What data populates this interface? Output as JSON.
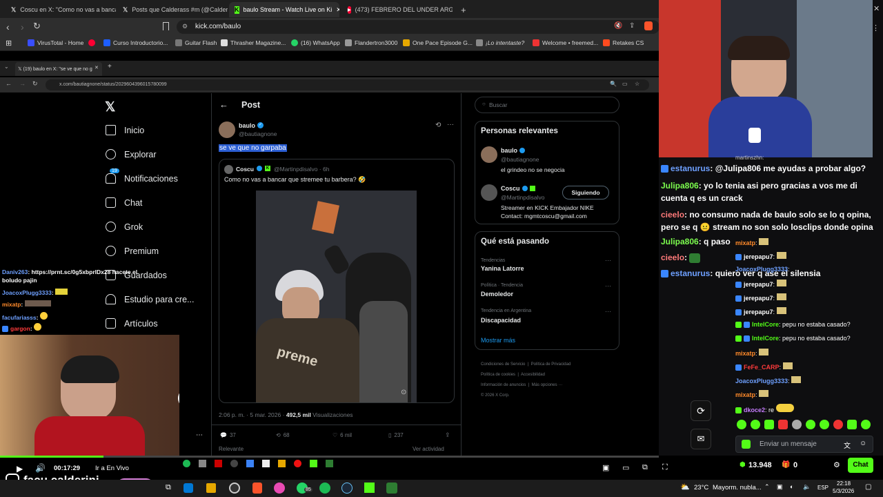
{
  "colors": {
    "kick_green": "#53fc18",
    "x_blue": "#1d9bf0",
    "x_bg": "#000000",
    "chat_bg": "#0e0e10"
  },
  "outer_browser": {
    "tabs": [
      {
        "label": "Coscu en X: \"Como no vas a bancar q",
        "icon": "x-logo-icon"
      },
      {
        "label": "Posts que Calderass #m (@CalderiniFa",
        "icon": "x-logo-icon"
      },
      {
        "label": "baulo Stream - Watch Live on Ki",
        "icon": "kick-icon",
        "active": true
      },
      {
        "label": "(473) FEBRERO DEL UNDER ARGENT",
        "icon": "youtube-icon"
      }
    ],
    "new_tab": "+",
    "address": "kick.com/baulo",
    "bookmarks": [
      {
        "label": "VirusTotal - Home"
      },
      {
        "label": ""
      },
      {
        "label": "Curso Introductorio..."
      },
      {
        "label": "Guitar Flash"
      },
      {
        "label": "Thrasher Magazine..."
      },
      {
        "label": "(16) WhatsApp"
      },
      {
        "label": "Flandertron3000"
      },
      {
        "label": "One Pace Episode G..."
      },
      {
        "label": "¡Lo intentaste?"
      },
      {
        "label": "Welcome • freemed..."
      },
      {
        "label": "Retakes CS"
      }
    ]
  },
  "inner_browser": {
    "tab_label": "(19) baulo en X: \"se ve que no g",
    "address": "x.com/bautiagnone/status/2029604396015780099"
  },
  "x_nav": {
    "items": [
      {
        "label": "Inicio",
        "icon": "home-icon"
      },
      {
        "label": "Explorar",
        "icon": "search-icon"
      },
      {
        "label": "Notificaciones",
        "icon": "bell-icon",
        "badge": "19"
      },
      {
        "label": "Chat",
        "icon": "mail-icon"
      },
      {
        "label": "Grok",
        "icon": "grok-icon"
      },
      {
        "label": "Premium",
        "icon": "premium-icon"
      },
      {
        "label": "Guardados",
        "icon": "bookmark-icon"
      },
      {
        "label": "Estudio para cre...",
        "icon": "studio-icon"
      },
      {
        "label": "Artículos",
        "icon": "articles-icon"
      }
    ]
  },
  "post": {
    "header": "Post",
    "author_name": "baulo",
    "author_handle": "@bautiagnone",
    "text": "se ve que no garpaba",
    "quoted": {
      "author_name": "Coscu",
      "author_handle": "@Martinpdisalvo · 6h",
      "text": "Como no vas a bancar que stremee tu barbera? 🤣"
    },
    "timestamp": "2:06 p. m. · 5 mar. 2026 ·",
    "views_count": "492,5 mil",
    "views_label": "Visualizaciones",
    "stats": {
      "replies": "37",
      "reposts": "68",
      "likes": "6 mil",
      "bookmarks": "237"
    },
    "relevant_label": "Relevante",
    "activity_label": "Ver actividad"
  },
  "sidebar_right": {
    "search_placeholder": "Buscar",
    "relevant_title": "Personas relevantes",
    "people": [
      {
        "name": "baulo",
        "handle": "@bautiagnone",
        "bio": "el grindeo no se negocia"
      },
      {
        "name": "Coscu",
        "handle": "@Martinpdisalvo",
        "bio": "Streamer en KICK Embajador NIKE Contact: mgmtcoscu@gmail.com",
        "follow_label": "Siguiendo"
      }
    ],
    "trending_title": "Qué está pasando",
    "trends": [
      {
        "context": "Tendencias",
        "name": "Yanina Latorre"
      },
      {
        "context": "Política · Tendencia",
        "name": "Demoledor"
      },
      {
        "context": "Tendencia en Argentina",
        "name": "Discapacidad"
      }
    ],
    "show_more": "Mostrar más",
    "footer": [
      "Condiciones de Servicio",
      "Política de Privacidad",
      "Política de cookies",
      "Accesibilidad",
      "Información de anuncios",
      "Más opciones ···",
      "© 2026 X Corp."
    ]
  },
  "left_overlay_chat": [
    {
      "user": "Daniv263",
      "text": ": https://prnt.sc/0g5xbprlDx28 hacete el boludo pajin"
    },
    {
      "user": "JoacoxPlugg3333",
      "text": ":"
    },
    {
      "user": "mixatp",
      "text": ":"
    },
    {
      "user": "facufariasss",
      "text": ":"
    },
    {
      "user": "gargon",
      "text": ":"
    }
  ],
  "stream_overlay_chat": [
    {
      "user": "estanurus",
      "text": ": @Julipa806 me ayudas a probar algo?"
    },
    {
      "user": "Julipa806",
      "text": ": yo lo tenia asi pero gracias a vos me di cuenta q es un crack"
    },
    {
      "user": "cieelo",
      "text": ": no consumo nada de baulo solo se lo q opina, pero se q 😐 stream no son solo losclips donde opina"
    },
    {
      "user": "Julipa806",
      "text": ": q paso"
    },
    {
      "user": "cieelo",
      "text": ":"
    },
    {
      "user": "estanurus",
      "text": ": quiero ver q ase el silensia"
    }
  ],
  "kick_chat": [
    {
      "user": "martinszhn",
      "text": ":"
    },
    {
      "user": "mixatp",
      "text": ":"
    },
    {
      "user": "jerepapu7",
      "text": ":"
    },
    {
      "user": "JoacoxPlugg3333",
      "text": ":"
    },
    {
      "user": "jerepapu7",
      "text": ":"
    },
    {
      "user": "jerepapu7",
      "text": ":"
    },
    {
      "user": "jerepapu7",
      "text": ":"
    },
    {
      "user": "IntelCore",
      "text": ": pepu no estaba casado?"
    },
    {
      "user": "IntelCore",
      "text": ": pepu no estaba casado?"
    },
    {
      "user": "mixatp",
      "text": ":"
    },
    {
      "user": "FeFe_CARP",
      "text": ":"
    },
    {
      "user": "JoacoxPlugg3333",
      "text": ":"
    },
    {
      "user": "mixatp",
      "text": ":"
    },
    {
      "user": "dkoce2",
      "text": ": re"
    }
  ],
  "chat_input": {
    "placeholder": "Enviar un mensaje"
  },
  "chat_footer": {
    "kicks": "13.948",
    "gifts": "0",
    "chat_button": "Chat"
  },
  "player": {
    "time": "00:17:29",
    "live_label": "Ir a En Vivo"
  },
  "streamer_name": "facu.calderini",
  "taskbar": {
    "weather": "23°C",
    "weather_desc": "Mayorm. nubla...",
    "lang": "ESP",
    "time": "22:18",
    "date": "5/3/2026",
    "search_badge": "85"
  }
}
